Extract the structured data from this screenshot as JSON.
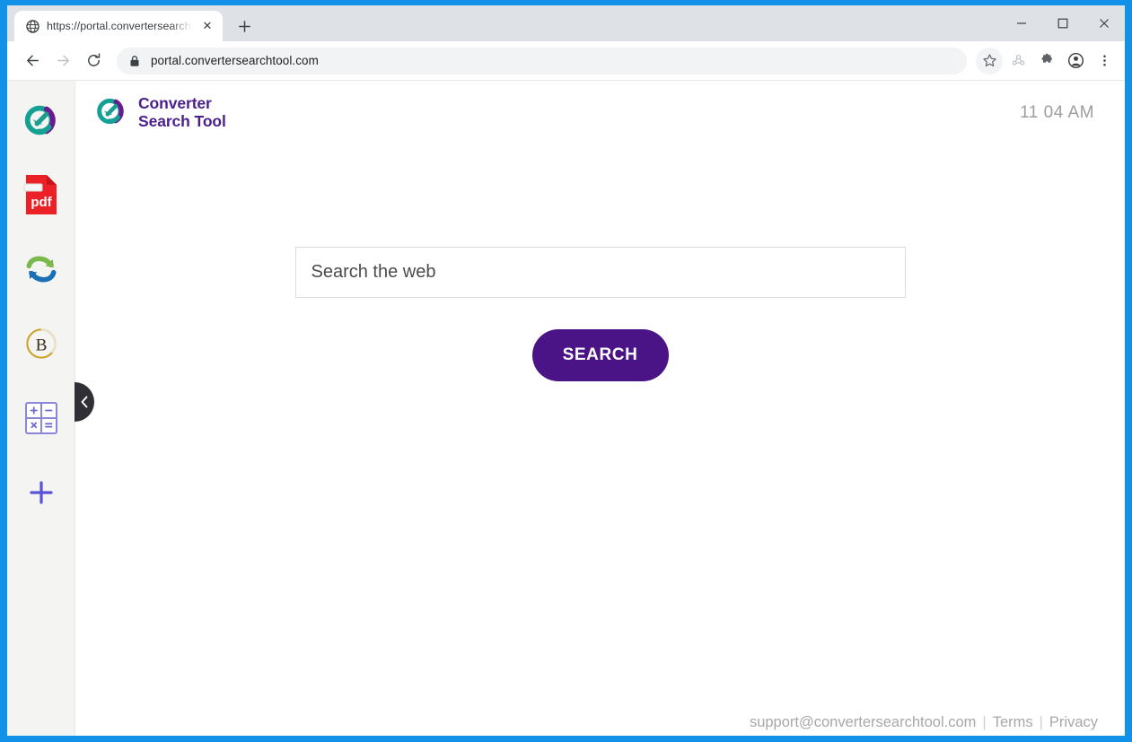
{
  "browser": {
    "tab": {
      "title": "https://portal.convertersearchtoo",
      "favicon_name": "globe-icon",
      "close_label": "✕"
    },
    "new_tab_label": "+",
    "window_controls": {
      "minimize": "–",
      "maximize": "□",
      "close": "✕"
    },
    "nav": {
      "back": "←",
      "forward": "→",
      "reload": "⟳"
    },
    "omnibox": {
      "url": "portal.convertersearchtool.com",
      "lock_icon": "lock-icon"
    },
    "toolbar_icons": [
      {
        "name": "bookmark-star-icon",
        "glyph": "☆"
      },
      {
        "name": "share-people-icon",
        "glyph": "⛭"
      },
      {
        "name": "extensions-puzzle-icon",
        "glyph": "❖"
      },
      {
        "name": "profile-avatar-icon",
        "glyph": "●"
      },
      {
        "name": "more-menu-icon",
        "glyph": "⋮"
      }
    ]
  },
  "sidebar": {
    "items": [
      {
        "name": "sidebar-logo-icon",
        "label": "Converter Search Tool"
      },
      {
        "name": "sidebar-pdf-icon",
        "label": "pdf"
      },
      {
        "name": "sidebar-convert-arrows-icon",
        "label": "Convert"
      },
      {
        "name": "sidebar-bitcoin-b-icon",
        "label": "B"
      },
      {
        "name": "sidebar-calculator-icon",
        "label": "Calculator"
      },
      {
        "name": "sidebar-add-icon",
        "label": "+"
      }
    ],
    "collapse_handle": "‹"
  },
  "header": {
    "brand_line1": "Converter",
    "brand_line2": "Search Tool",
    "clock": "11 04 AM"
  },
  "main": {
    "search_placeholder": "Search the web",
    "search_value": "",
    "search_button_label": "SEARCH"
  },
  "footer": {
    "email": "support@convertersearchtool.com",
    "separator1": "|",
    "terms": "Terms",
    "separator2": "|",
    "privacy": "Privacy"
  },
  "colors": {
    "window_border": "#1291e8",
    "brand_purple": "#4b1f8c",
    "button_purple": "#4b1486",
    "sidebar_bg": "#f4f4f3",
    "tabstrip_bg": "#dee1e6"
  }
}
